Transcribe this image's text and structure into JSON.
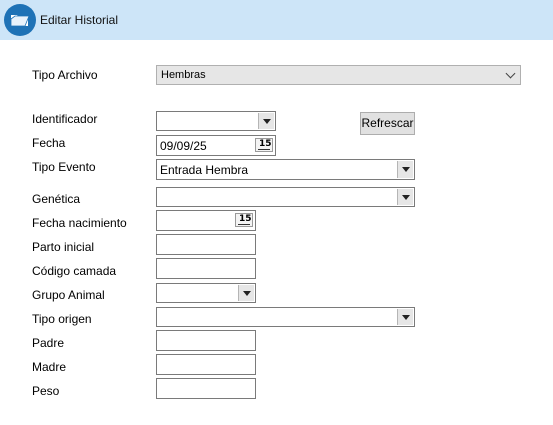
{
  "window": {
    "title": "Editar Historial",
    "icon": "folder-open-icon",
    "accent": "#1e72b6",
    "titlebar_bg": "#cde5f8"
  },
  "tipo_archivo": {
    "label": "Tipo Archivo",
    "value": "Hembras"
  },
  "form": {
    "identificador": {
      "label": "Identificador",
      "value": ""
    },
    "refrescar_label": "Refrescar",
    "fecha": {
      "label": "Fecha",
      "value": "09/09/25",
      "calendar_icon": "15"
    },
    "tipo_evento": {
      "label": "Tipo Evento",
      "value": "Entrada Hembra"
    },
    "genetica": {
      "label": "Genética",
      "value": ""
    },
    "fecha_nacimiento": {
      "label": "Fecha nacimiento",
      "value": "",
      "calendar_icon": "15"
    },
    "parto_inicial": {
      "label": "Parto inicial",
      "value": ""
    },
    "codigo_camada": {
      "label": "Código camada",
      "value": ""
    },
    "grupo_animal": {
      "label": "Grupo Animal",
      "value": ""
    },
    "tipo_origen": {
      "label": "Tipo origen",
      "value": ""
    },
    "padre": {
      "label": "Padre",
      "value": ""
    },
    "madre": {
      "label": "Madre",
      "value": ""
    },
    "peso": {
      "label": "Peso",
      "value": ""
    }
  }
}
